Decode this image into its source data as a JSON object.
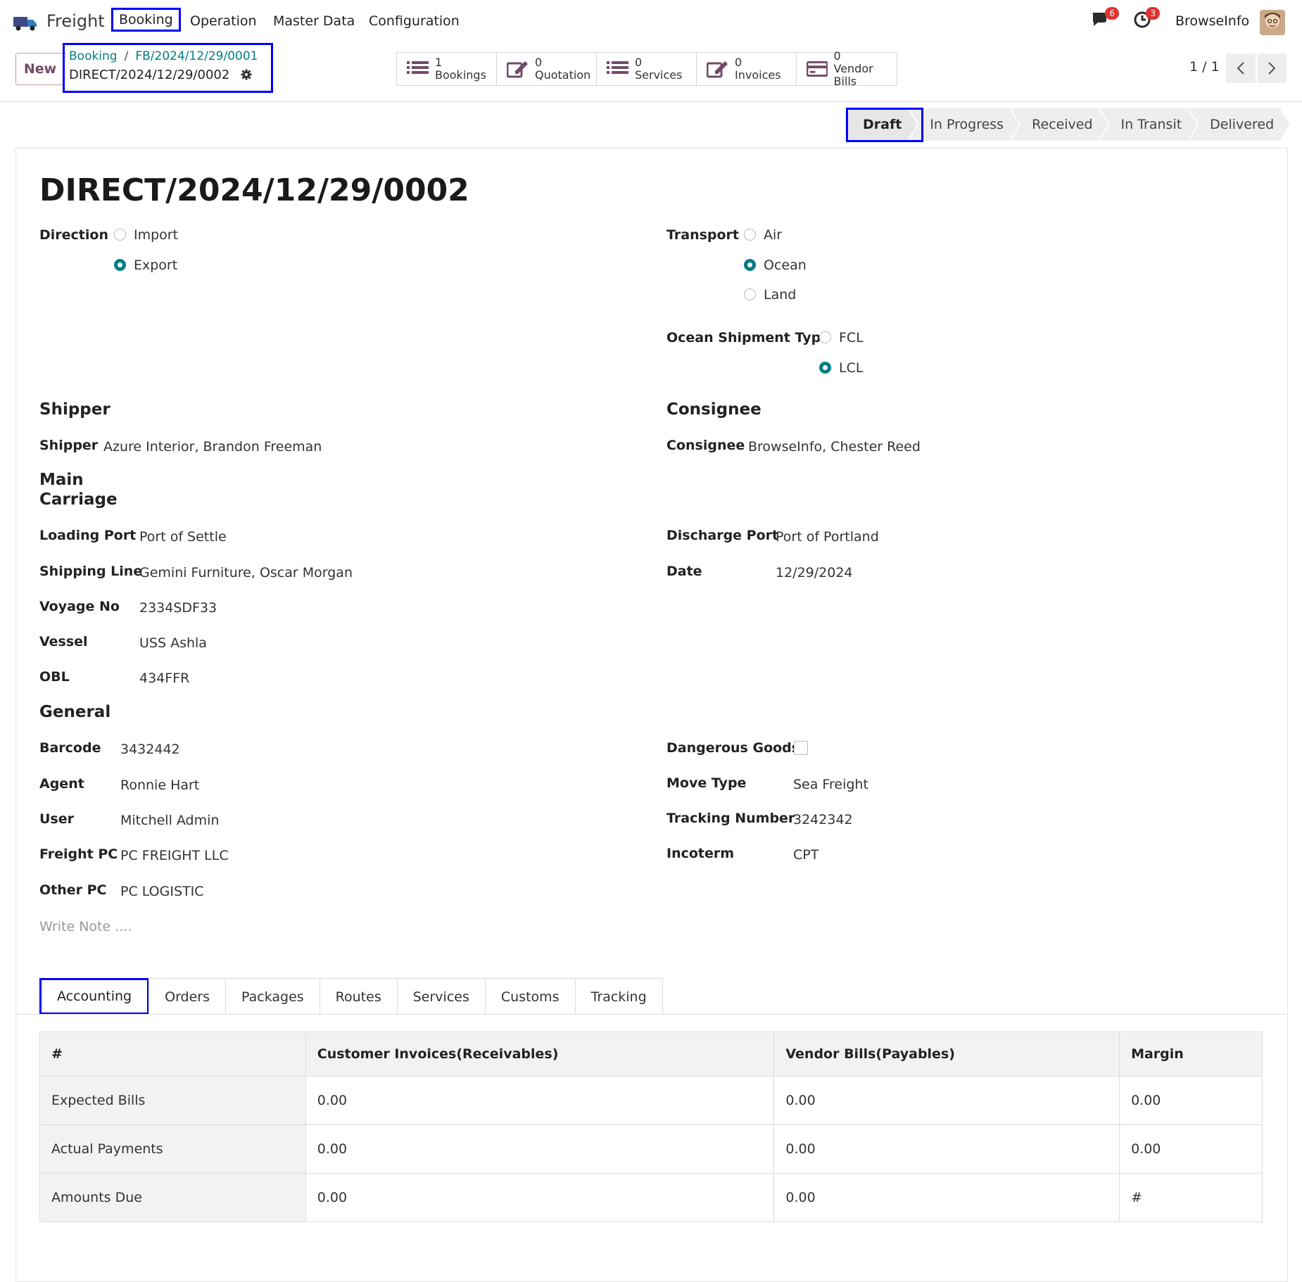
{
  "topbar": {
    "app_name": "Freight",
    "menu": [
      "Booking",
      "Operation",
      "Master Data",
      "Configuration"
    ],
    "messages_badge": "6",
    "activities_badge": "3",
    "user_name": "BrowseInfo"
  },
  "controls": {
    "new_label": "New",
    "breadcrumb_root": "Booking",
    "breadcrumb_parent": "FB/2024/12/29/0001",
    "breadcrumb_current": "DIRECT/2024/12/29/0002",
    "pager": "1 / 1"
  },
  "smart_buttons": [
    {
      "count": "1",
      "label": "Bookings",
      "icon": "list-icon"
    },
    {
      "count": "0",
      "label": "Quotation",
      "icon": "edit-icon"
    },
    {
      "count": "0",
      "label": "Services",
      "icon": "list-icon"
    },
    {
      "count": "0",
      "label": "Invoices",
      "icon": "edit-icon"
    },
    {
      "count": "0",
      "label": "Vendor Bills",
      "icon": "credit-card-icon"
    }
  ],
  "stages": [
    "Draft",
    "In Progress",
    "Received",
    "In Transit",
    "Delivered"
  ],
  "active_stage": "Draft",
  "record": {
    "title": "DIRECT/2024/12/29/0002",
    "direction_label": "Direction",
    "direction_options": [
      "Import",
      "Export"
    ],
    "direction_selected": "Export",
    "transport_label": "Transport",
    "transport_options": [
      "Air",
      "Ocean",
      "Land"
    ],
    "transport_selected": "Ocean",
    "ocean_type_label": "Ocean Shipment Type",
    "ocean_type_options": [
      "FCL",
      "LCL"
    ],
    "ocean_type_selected": "LCL"
  },
  "shipper": {
    "section": "Shipper",
    "label": "Shipper",
    "value": "Azure Interior, Brandon Freeman"
  },
  "consignee": {
    "section": "Consignee",
    "label": "Consignee",
    "value": "BrowseInfo, Chester Reed"
  },
  "main_carriage": {
    "section_line1": "Main",
    "section_line2": "Carriage",
    "loading_port_label": "Loading Port",
    "loading_port": "Port of Settle",
    "shipping_line_label": "Shipping Line",
    "shipping_line": "Gemini Furniture, Oscar Morgan",
    "voyage_label": "Voyage No",
    "voyage": "2334SDF33",
    "vessel_label": "Vessel",
    "vessel": "USS Ashla",
    "obl_label": "OBL",
    "obl": "434FFR",
    "discharge_port_label": "Discharge Port",
    "discharge_port": "Port of Portland",
    "date_label": "Date",
    "date": "12/29/2024"
  },
  "general": {
    "section": "General",
    "barcode_label": "Barcode",
    "barcode": "3432442",
    "agent_label": "Agent",
    "agent": "Ronnie Hart",
    "user_label": "User",
    "user": "Mitchell Admin",
    "freight_pc_label": "Freight PC",
    "freight_pc": "PC FREIGHT LLC",
    "other_pc_label": "Other PC",
    "other_pc": "PC LOGISTIC",
    "dangerous_label": "Dangerous Goods",
    "dangerous": false,
    "move_type_label": "Move Type",
    "move_type": "Sea Freight",
    "tracking_label": "Tracking Number",
    "tracking": "3242342",
    "incoterm_label": "Incoterm",
    "incoterm": "CPT",
    "note_placeholder": "Write Note ...."
  },
  "tabs": [
    "Accounting",
    "Orders",
    "Packages",
    "Routes",
    "Services",
    "Customs",
    "Tracking"
  ],
  "active_tab": "Accounting",
  "accounting_table": {
    "headers": [
      "#",
      "Customer Invoices(Receivables)",
      "Vendor Bills(Payables)",
      "Margin"
    ],
    "rows": [
      [
        "Expected Bills",
        "0.00",
        "0.00",
        "0.00"
      ],
      [
        "Actual Payments",
        "0.00",
        "0.00",
        "0.00"
      ],
      [
        "Amounts Due",
        "0.00",
        "0.00",
        "#"
      ]
    ]
  },
  "colors": {
    "accent": "#017e84",
    "brand": "#714B67",
    "highlight": "#0000ff",
    "badge": "#e0322f"
  }
}
